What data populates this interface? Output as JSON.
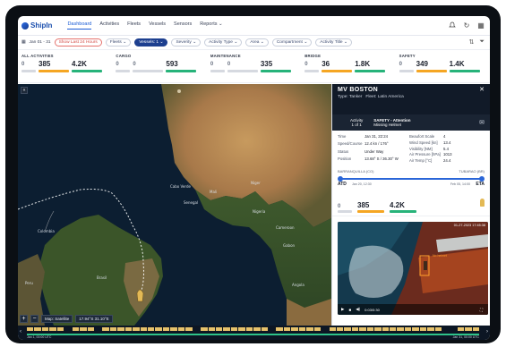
{
  "app": {
    "logo": "ShipIn"
  },
  "nav": {
    "items": [
      "Dashboard",
      "Activities",
      "Fleets",
      "Vessels",
      "Sensors",
      "Reports ⌄"
    ],
    "active": "Dashboard"
  },
  "filters": {
    "date_range": "Jan 01 - 31",
    "show_last": "Show Last 24 Hours",
    "pills": [
      {
        "label": "Fleets",
        "active": false
      },
      {
        "label": "Vessels: 1",
        "active": true
      },
      {
        "label": "Severity",
        "active": false
      },
      {
        "label": "Activity Type",
        "active": false
      },
      {
        "label": "Area",
        "active": false
      },
      {
        "label": "Compartment",
        "active": false
      },
      {
        "label": "Activity Title",
        "active": false
      }
    ]
  },
  "stats": [
    {
      "label": "ALL ACTIVITIES",
      "v1": "0",
      "v2": "385",
      "v3": "4.2K"
    },
    {
      "label": "CARGO",
      "v1": "0",
      "v2": "0",
      "v3": "593"
    },
    {
      "label": "MAINTENANCE",
      "v1": "0",
      "v2": "0",
      "v3": "335"
    },
    {
      "label": "BRIDGE",
      "v1": "0",
      "v2": "36",
      "v3": "1.8K"
    },
    {
      "label": "SAFETY",
      "v1": "0",
      "v2": "349",
      "v3": "1.4K"
    }
  ],
  "map": {
    "labels": [
      "Cabo Verde",
      "Senegal",
      "Mali",
      "Niger",
      "Nigeria",
      "Cameroon",
      "Gabon",
      "Angola",
      "Brasil",
      "Peru",
      "Colombia"
    ],
    "map_type": "Map: Satellite",
    "coords": "17.94°S 31.10°E"
  },
  "vessel": {
    "name": "MV BOSTON",
    "type_label": "Type: Tanker",
    "fleet_label": "Fleet: Latin America",
    "activity_label": "Activity",
    "activity_count": "1 of 1",
    "alert_title": "SAFETY - Attention",
    "alert_sub": "Missing Helmet",
    "details_left": [
      {
        "k": "Time",
        "v": "Jan 31, 22:24"
      },
      {
        "k": "Speed/Course",
        "v": "12.4 kn / 176°"
      },
      {
        "k": "Status",
        "v": "Under Way"
      },
      {
        "k": "Position",
        "v": "13.68° S / 36.30° W"
      }
    ],
    "details_right": [
      {
        "k": "Beaufort Scale",
        "v": "4"
      },
      {
        "k": "Wind Speed [kn]",
        "v": "13.4"
      },
      {
        "k": "Visibility [NM]",
        "v": "5.4"
      },
      {
        "k": "Air Pressure [hPa]",
        "v": "1013"
      },
      {
        "k": "Air Temp [°C]",
        "v": "24.4"
      }
    ],
    "route": {
      "from": "BARRANQUILLA (CO)",
      "to": "TUBARAO (BR)",
      "atd": "ATD",
      "eta": "ETA",
      "atd_date": "Jan 20, 12:30",
      "eta_date": "Feb 05, 14:00"
    },
    "stats": {
      "v1": "0",
      "v2": "385",
      "v3": "4.2K"
    },
    "video": {
      "timestamp": "01-27-2023 17:45:38",
      "time": "0:03/0:30",
      "box_label": "No helmet"
    }
  },
  "timeline": {
    "start": "Jan 1, 00:00 UTC",
    "end": "Jan 31, 00:00 UTC"
  },
  "colors": {
    "accent": "#1d3f8f",
    "orange": "#f5a623",
    "green": "#27b37a"
  }
}
